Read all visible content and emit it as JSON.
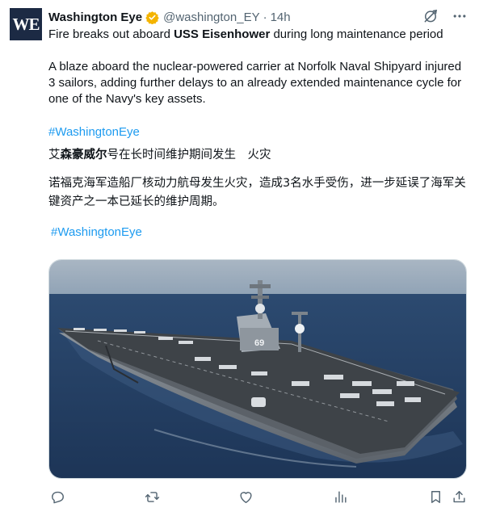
{
  "account": {
    "avatar_text": "WE",
    "name": "Washington Eye",
    "handle": "@washington_EY",
    "separator": "·",
    "time": "14h",
    "verified_color": "#f4b400"
  },
  "post": {
    "headline_pre": "Fire breaks out aboard ",
    "headline_bold": "USS Eisenhower",
    "headline_post": " during long maintenance period",
    "body_en": "A blaze aboard the nuclear-powered carrier at Norfolk Naval Shipyard injured 3 sailors, adding further delays to an already extended maintenance cycle for one of the Navy's key assets.",
    "hashtag_1": "#WashingtonEye",
    "zh_headline_pre": "艾",
    "zh_headline_bold": "森豪威尔",
    "zh_headline_post": "号在长时间维护期间发生　火灾",
    "zh_body": "诺福克海军造船厂核动力航母发生火灾，造成3名水手受伤，进一步延误了海军关键资产之一本已延长的维护周期。",
    "hashtag_2": "#WashingtonEye",
    "hashtag_color": "#1d9bf0"
  },
  "media": {
    "description_icon": "aircraft-carrier-photo",
    "hull_number": "69"
  },
  "icons": {
    "grok": "grok-icon",
    "more": "more-icon",
    "reply": "reply-icon",
    "repost": "repost-icon",
    "like": "like-icon",
    "views": "views-icon",
    "bookmark": "bookmark-icon",
    "share": "share-icon"
  }
}
